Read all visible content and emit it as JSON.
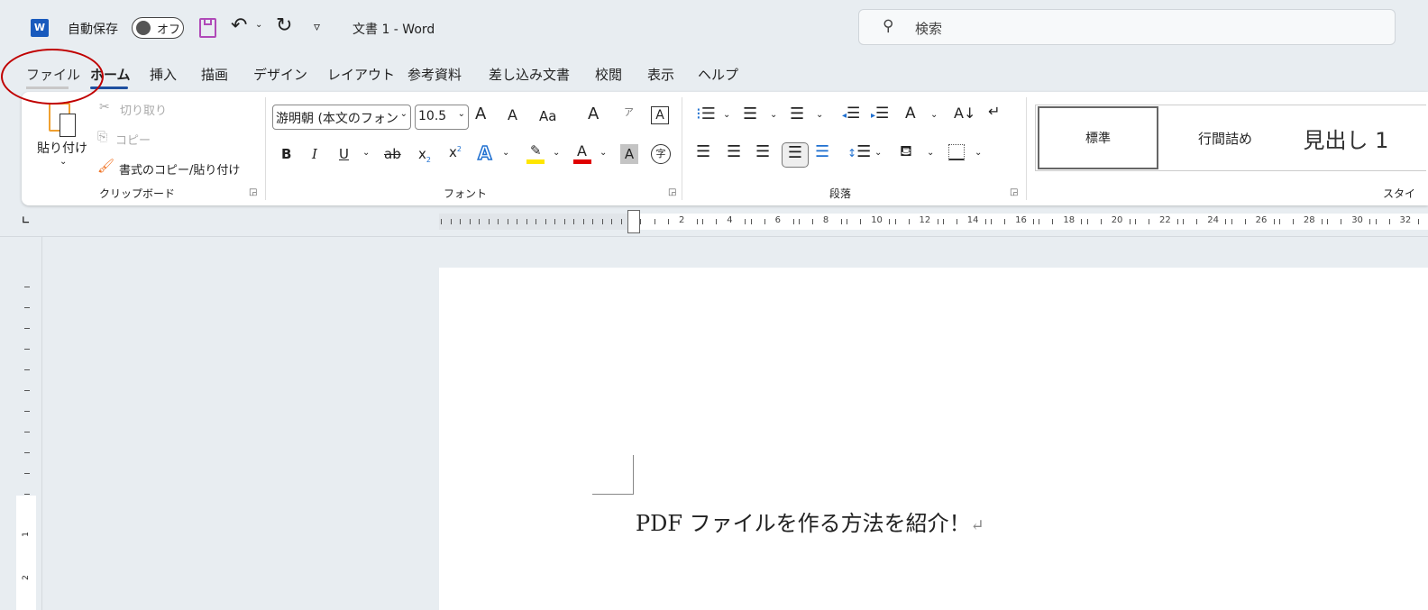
{
  "titlebar": {
    "autosave_label": "自動保存",
    "autosave_state": "オフ",
    "doc_title": "文書 1  -  Word",
    "search_placeholder": "検索",
    "qat_more": "▿"
  },
  "tabs": [
    "ファイル",
    "ホーム",
    "挿入",
    "描画",
    "デザイン",
    "レイアウト",
    "参考資料",
    "差し込み文書",
    "校閲",
    "表示",
    "ヘルプ"
  ],
  "active_tab": "ホーム",
  "clipboard": {
    "paste": "貼り付け",
    "cut": "切り取り",
    "copy": "コピー",
    "format_painter": "書式のコピー/貼り付け",
    "group": "クリップボード"
  },
  "font": {
    "font_name": "游明朝 (本文のフォン",
    "font_size": "10.5",
    "grow": "A",
    "shrink": "A",
    "case": "Aa",
    "bold": "B",
    "italic": "I",
    "underline": "U",
    "strike": "ab",
    "subscript": "x",
    "superscript": "x",
    "text_effect": "A",
    "highlight_color": "#ffe600",
    "font_color_label": "A",
    "font_color": "#e00000",
    "char_shading": "A",
    "enclose": "字",
    "clear": "A",
    "phonetic": "ア",
    "border": "A",
    "group": "フォント"
  },
  "paragraph": {
    "group": "段落"
  },
  "styles": {
    "items": [
      "標準",
      "行間詰め",
      "見出し 1"
    ],
    "group": "スタイ"
  },
  "ruler": {
    "labels": [
      "2",
      "4",
      "6",
      "8",
      "10",
      "12",
      "14",
      "16",
      "18",
      "20",
      "22",
      "24",
      "26",
      "28",
      "30",
      "32"
    ]
  },
  "vruler": {
    "labels": [
      "1",
      "2"
    ]
  },
  "document": {
    "text": "PDF ファイルを作る方法を紹介！",
    "para_mark": "↵"
  },
  "annotation": {
    "color": "#c00000"
  },
  "colors": {
    "word_blue": "#185abd",
    "accent_blue": "#1e6fd0",
    "save_purple": "#b04ab8"
  }
}
